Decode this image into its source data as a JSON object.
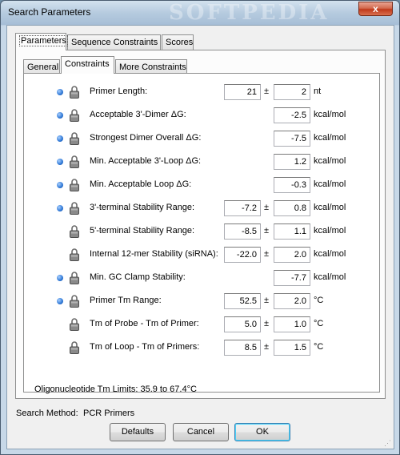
{
  "window": {
    "title": "Search Parameters",
    "watermark": "SOFTPEDIA",
    "close_label": "x"
  },
  "tabs": [
    "Parameters",
    "Sequence Constraints",
    "Scores"
  ],
  "inner_tabs": [
    "General",
    "Constraints",
    "More Constraints"
  ],
  "rows": [
    {
      "label": "Primer Length:",
      "bullet": true,
      "v1": "21",
      "v2": "2",
      "unit": "nt"
    },
    {
      "label": "Acceptable 3'-Dimer ΔG:",
      "bullet": true,
      "v1": null,
      "v2": "-2.5",
      "unit": "kcal/mol"
    },
    {
      "label": "Strongest Dimer Overall ΔG:",
      "bullet": true,
      "v1": null,
      "v2": "-7.5",
      "unit": "kcal/mol"
    },
    {
      "label": "Min. Acceptable 3'-Loop ΔG:",
      "bullet": true,
      "v1": null,
      "v2": "1.2",
      "unit": "kcal/mol"
    },
    {
      "label": "Min. Acceptable Loop ΔG:",
      "bullet": true,
      "v1": null,
      "v2": "-0.3",
      "unit": "kcal/mol"
    },
    {
      "label": "3'-terminal Stability Range:",
      "bullet": true,
      "v1": "-7.2",
      "v2": "0.8",
      "unit": "kcal/mol"
    },
    {
      "label": "5'-terminal Stability Range:",
      "bullet": false,
      "v1": "-8.5",
      "v2": "1.1",
      "unit": "kcal/mol"
    },
    {
      "label": "Internal 12-mer Stability (siRNA):",
      "bullet": false,
      "v1": "-22.0",
      "v2": "2.0",
      "unit": "kcal/mol"
    },
    {
      "label": "Min. GC Clamp Stability:",
      "bullet": true,
      "v1": null,
      "v2": "-7.7",
      "unit": "kcal/mol"
    },
    {
      "label": "Primer Tm Range:",
      "bullet": true,
      "v1": "52.5",
      "v2": "2.0",
      "unit": "°C"
    },
    {
      "label": "Tm of Probe - Tm of Primer:",
      "bullet": false,
      "v1": "5.0",
      "v2": "1.0",
      "unit": "°C"
    },
    {
      "label": "Tm of Loop - Tm of Primers:",
      "bullet": false,
      "v1": "8.5",
      "v2": "1.5",
      "unit": "°C"
    }
  ],
  "plus_minus": "±",
  "tm_limits": "Oligonucleotide Tm Limits: 35.9 to 67.4°C",
  "search_method": {
    "label": "Search Method:",
    "value": "PCR Primers"
  },
  "buttons": {
    "defaults": "Defaults",
    "cancel": "Cancel",
    "ok": "OK"
  }
}
